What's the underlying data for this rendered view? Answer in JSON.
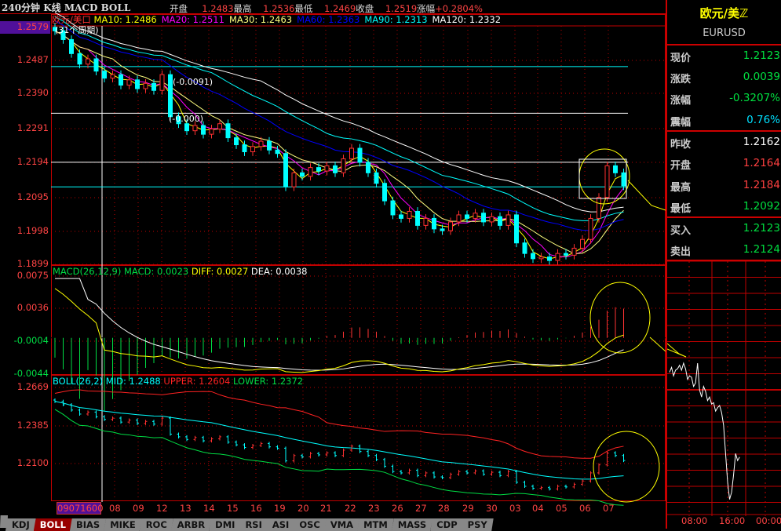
{
  "header": {
    "title": "240分钟 K线 MACD BOLL",
    "quote": [
      {
        "label": "开盘",
        "value": "1.2483"
      },
      {
        "label": "最高",
        "value": "1.2536"
      },
      {
        "label": "最低",
        "value": "1.2469"
      },
      {
        "label": "收盘",
        "value": "1.2519"
      },
      {
        "label": "涨幅",
        "value": "+0.2804%"
      }
    ]
  },
  "main_legend": {
    "name": "欧元/美口",
    "ma": [
      {
        "label": "MA10: 1.2486",
        "color": "#ffff00"
      },
      {
        "label": "MA20: 1.2511",
        "color": "#ff00ff"
      },
      {
        "label": "MA30: 1.2463",
        "color": "#ffff80"
      },
      {
        "label": "MA60: 1.2363",
        "color": "#0000ff"
      },
      {
        "label": "MA90: 1.2313",
        "color": "#00ffff"
      },
      {
        "label": "MA120: 1.2332",
        "color": "#ffffff"
      }
    ]
  },
  "main_axis": {
    "current": "1.2579",
    "ticks": [
      "1.2487",
      "1.2390",
      "1.2291",
      "1.2194",
      "1.2095",
      "1.1998",
      "1.1899"
    ]
  },
  "annotations": [
    "(31个周期)",
    "(-0.0091)",
    "(-0.000)"
  ],
  "macd_legend": {
    "name": "MACD(26,12,9)",
    "macd": "MACD: 0.0023",
    "diff": "DIFF: 0.0027",
    "dea": "DEA: 0.0038"
  },
  "macd_axis": [
    "0.0075",
    "0.0036",
    "-0.0004",
    "-0.0044"
  ],
  "boll_legend": {
    "name": "BOLL(26,2)",
    "mid": "MID: 1.2488",
    "upper": "UPPER: 1.2604",
    "lower": "LOWER: 1.2372"
  },
  "boll_axis": [
    "1.2669",
    "1.2385",
    "1.2100"
  ],
  "x_axis": {
    "cursor": "09071600",
    "dates": [
      "08",
      "09",
      "12",
      "13",
      "14",
      "15",
      "16",
      "19",
      "20",
      "21",
      "22",
      "23",
      "26",
      "27",
      "28",
      "29",
      "30",
      "03",
      "04",
      "05",
      "06",
      "07"
    ]
  },
  "tabs": [
    "KDJ",
    "BOLL",
    "BIAS",
    "MIKE",
    "ROC",
    "ARBR",
    "DMI",
    "RSI",
    "ASI",
    "OSC",
    "VMA",
    "MTM",
    "MASS",
    "CDP",
    "PSY"
  ],
  "active_tab": "BOLL",
  "quote_panel": {
    "name": "欧元/美ℤ",
    "code": "EURUSD",
    "rows": [
      {
        "label": "现价",
        "value": "1.2123",
        "color": "#00e040"
      },
      {
        "label": "涨跌",
        "value": "0.0039",
        "color": "#00e040"
      },
      {
        "label": "涨幅",
        "value": "-0.3207%",
        "color": "#00e040"
      },
      {
        "label": "震幅",
        "value": "0.76%",
        "color": "#00e0ff"
      },
      {
        "label": "昨收",
        "value": "1.2162",
        "color": "#ffffff"
      },
      {
        "label": "开盘",
        "value": "1.2164",
        "color": "#ff4040"
      },
      {
        "label": "最高",
        "value": "1.2184",
        "color": "#ff4040"
      },
      {
        "label": "最低",
        "value": "1.2092",
        "color": "#00e040"
      },
      {
        "label": "买入",
        "value": "1.2123",
        "color": "#00e040"
      },
      {
        "label": "卖出",
        "value": "1.2124",
        "color": "#00e040"
      }
    ]
  },
  "intraday": {
    "times": [
      "08:00",
      "16:00",
      "00:00"
    ],
    "values": [
      1.2155,
      1.2162,
      1.215,
      1.2158,
      1.216,
      1.2165,
      1.2158,
      1.2168,
      1.216,
      1.2145,
      1.215,
      1.2148,
      1.2135,
      1.214,
      1.2168,
      1.213,
      1.212,
      1.2135,
      1.2128,
      1.2115,
      1.212,
      1.211,
      1.2112,
      1.21,
      1.2105,
      1.2108,
      1.2098,
      1.208,
      1.204,
      1.2,
      1.1975,
      1.1985,
      1.201,
      1.204,
      1.203,
      1.2035
    ]
  },
  "chart_data": {
    "type": "candlestick",
    "closes": [
      1.2565,
      1.254,
      1.25,
      1.247,
      1.2485,
      1.245,
      1.243,
      1.244,
      1.241,
      1.2425,
      1.24,
      1.2415,
      1.2395,
      1.244,
      1.232,
      1.23,
      1.228,
      1.2295,
      1.227,
      1.2285,
      1.23,
      1.226,
      1.224,
      1.222,
      1.2235,
      1.225,
      1.2225,
      1.2215,
      1.212,
      1.216,
      1.215,
      1.2175,
      1.2165,
      1.218,
      1.216,
      1.22,
      1.223,
      1.219,
      1.216,
      1.213,
      1.208,
      1.204,
      1.203,
      1.205,
      1.201,
      1.203,
      1.2,
      1.1995,
      1.202,
      1.204,
      1.203,
      1.2045,
      1.202,
      1.2035,
      1.201,
      1.204,
      1.196,
      1.193,
      1.1915,
      1.192,
      1.191,
      1.193,
      1.1925,
      1.1945,
      1.197,
      1.203,
      1.209,
      1.218,
      1.216,
      1.2123
    ],
    "colors": {
      "up": "#ff3030",
      "down": "#00ffff",
      "grid": "#c00000"
    }
  }
}
